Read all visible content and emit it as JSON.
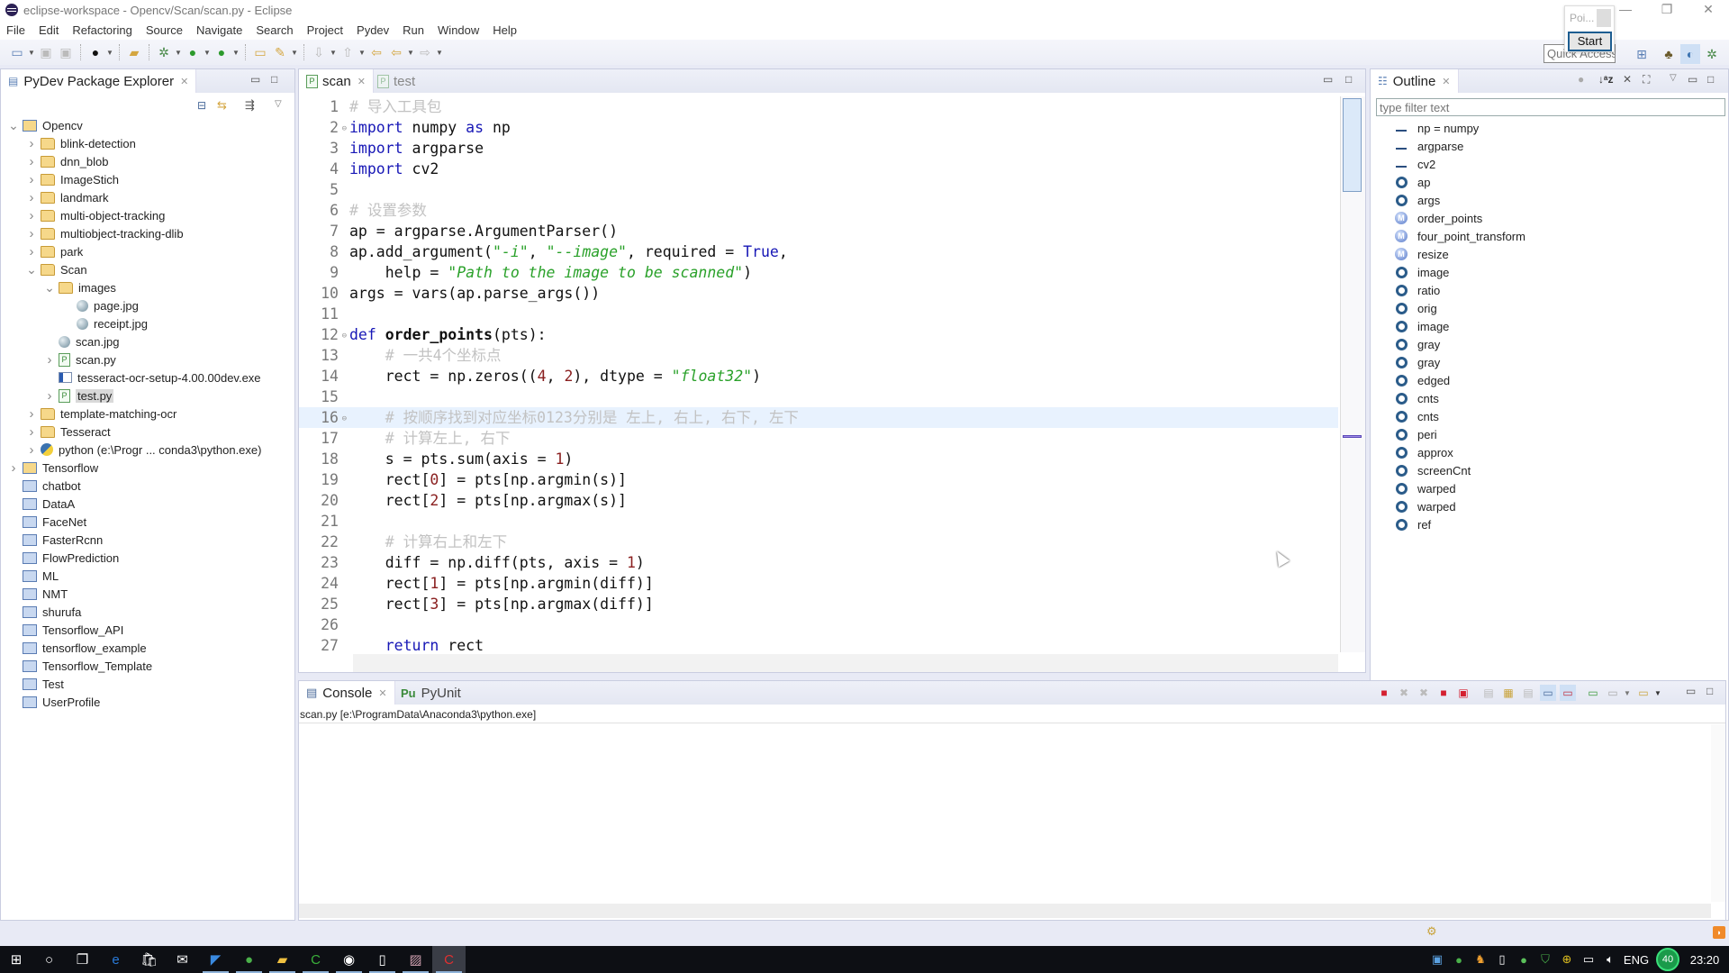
{
  "window": {
    "title": "eclipse-workspace - Opencv/Scan/scan.py - Eclipse",
    "controls": {
      "minimize": "—",
      "restore": "❐",
      "close": "✕"
    }
  },
  "menu": [
    "File",
    "Edit",
    "Refactoring",
    "Source",
    "Navigate",
    "Search",
    "Project",
    "Pydev",
    "Run",
    "Window",
    "Help"
  ],
  "toolbar": {
    "quick_access_placeholder": "Quick Access",
    "popup": {
      "text": "Poi...",
      "button": "Start"
    },
    "icons": [
      "new-icon",
      "save-icon",
      "save-all-icon",
      "profile-icon",
      "open-project-icon",
      "debug-icon",
      "run-icon",
      "external-tools-icon",
      "open-folder-icon",
      "pen-icon",
      "next-annotation-icon",
      "prev-annotation-icon",
      "last-edit-icon",
      "back-icon",
      "forward-icon"
    ],
    "perspectives": [
      "open-perspective-icon",
      "java-perspective-icon",
      "pydev-perspective-icon",
      "debug-perspective-icon"
    ]
  },
  "explorer": {
    "title": "PyDev Package Explorer",
    "tree": [
      {
        "label": "Opencv",
        "level": 0,
        "icon": "project",
        "expanded": true
      },
      {
        "label": "blink-detection",
        "level": 1,
        "icon": "folder",
        "collapsed": true
      },
      {
        "label": "dnn_blob",
        "level": 1,
        "icon": "folder",
        "collapsed": true
      },
      {
        "label": "ImageStich",
        "level": 1,
        "icon": "folder",
        "collapsed": true
      },
      {
        "label": "landmark",
        "level": 1,
        "icon": "folder",
        "collapsed": true
      },
      {
        "label": "multi-object-tracking",
        "level": 1,
        "icon": "folder",
        "collapsed": true
      },
      {
        "label": "multiobject-tracking-dlib",
        "level": 1,
        "icon": "folder",
        "collapsed": true
      },
      {
        "label": "park",
        "level": 1,
        "icon": "folder",
        "collapsed": true
      },
      {
        "label": "Scan",
        "level": 1,
        "icon": "folder",
        "expanded": true
      },
      {
        "label": "images",
        "level": 2,
        "icon": "folder",
        "expanded": true
      },
      {
        "label": "page.jpg",
        "level": 3,
        "icon": "image"
      },
      {
        "label": "receipt.jpg",
        "level": 3,
        "icon": "image"
      },
      {
        "label": "scan.jpg",
        "level": 2,
        "icon": "image"
      },
      {
        "label": "scan.py",
        "level": 2,
        "icon": "py",
        "collapsed": true
      },
      {
        "label": "tesseract-ocr-setup-4.00.00dev.exe",
        "level": 2,
        "icon": "exe"
      },
      {
        "label": "test.py",
        "level": 2,
        "icon": "py",
        "collapsed": true,
        "selected": true
      },
      {
        "label": "template-matching-ocr",
        "level": 1,
        "icon": "folder",
        "collapsed": true
      },
      {
        "label": "Tesseract",
        "level": 1,
        "icon": "folder",
        "collapsed": true
      },
      {
        "label": "python  (e:\\Progr ... conda3\\python.exe)",
        "level": 1,
        "icon": "python",
        "collapsed": true
      },
      {
        "label": "Tensorflow",
        "level": 0,
        "icon": "project",
        "collapsed": true
      },
      {
        "label": "chatbot",
        "level": 0,
        "icon": "closed"
      },
      {
        "label": "DataA",
        "level": 0,
        "icon": "closed"
      },
      {
        "label": "FaceNet",
        "level": 0,
        "icon": "closed"
      },
      {
        "label": "FasterRcnn",
        "level": 0,
        "icon": "closed"
      },
      {
        "label": "FlowPrediction",
        "level": 0,
        "icon": "closed"
      },
      {
        "label": "ML",
        "level": 0,
        "icon": "closed"
      },
      {
        "label": "NMT",
        "level": 0,
        "icon": "closed"
      },
      {
        "label": "shurufa",
        "level": 0,
        "icon": "closed"
      },
      {
        "label": "Tensorflow_API",
        "level": 0,
        "icon": "closed"
      },
      {
        "label": "tensorflow_example",
        "level": 0,
        "icon": "closed"
      },
      {
        "label": "Tensorflow_Template",
        "level": 0,
        "icon": "closed"
      },
      {
        "label": "Test",
        "level": 0,
        "icon": "closed"
      },
      {
        "label": "UserProfile",
        "level": 0,
        "icon": "closed"
      }
    ]
  },
  "editor": {
    "tabs": [
      {
        "label": "scan",
        "active": true
      },
      {
        "label": "test",
        "active": false
      }
    ],
    "current_line": 16,
    "lines": [
      [
        [
          "cmt",
          "# 导入工具包"
        ]
      ],
      [
        [
          "kw",
          "import"
        ],
        [
          "",
          " numpy "
        ],
        [
          "kw",
          "as"
        ],
        [
          "",
          " np"
        ]
      ],
      [
        [
          "kw",
          "import"
        ],
        [
          "",
          " argparse"
        ]
      ],
      [
        [
          "kw",
          "import"
        ],
        [
          "",
          " cv2"
        ]
      ],
      [],
      [
        [
          "cmt",
          "# 设置参数"
        ]
      ],
      [
        [
          "",
          "ap = argparse.ArgumentParser()"
        ]
      ],
      [
        [
          "",
          "ap.add_argument("
        ],
        [
          "str",
          "\"-i\""
        ],
        [
          "",
          ", "
        ],
        [
          "str",
          "\"--image\""
        ],
        [
          "",
          ", required = "
        ],
        [
          "kw",
          "True"
        ],
        [
          "",
          ","
        ]
      ],
      [
        [
          "",
          "    help = "
        ],
        [
          "str",
          "\"Path to the image to be scanned\""
        ],
        [
          "",
          ")"
        ]
      ],
      [
        [
          "",
          "args = vars(ap.parse_args())"
        ]
      ],
      [],
      [
        [
          "kw",
          "def"
        ],
        [
          "",
          " "
        ],
        [
          "fn",
          "order_points"
        ],
        [
          "",
          "(pts):"
        ]
      ],
      [
        [
          "",
          "    "
        ],
        [
          "cmt",
          "# 一共4个坐标点"
        ]
      ],
      [
        [
          "",
          "    rect = np.zeros(("
        ],
        [
          "num",
          "4"
        ],
        [
          "",
          ", "
        ],
        [
          "num",
          "2"
        ],
        [
          "",
          "), dtype = "
        ],
        [
          "str",
          "\"float32\""
        ],
        [
          "",
          ")"
        ]
      ],
      [],
      [
        [
          "",
          "    "
        ],
        [
          "cmt",
          "# 按顺序找到对应坐标0123分别是 左上, 右上, 右下, 左下"
        ]
      ],
      [
        [
          "",
          "    "
        ],
        [
          "cmt",
          "# 计算左上, 右下"
        ]
      ],
      [
        [
          "",
          "    s = pts.sum(axis = "
        ],
        [
          "num",
          "1"
        ],
        [
          "",
          ")"
        ]
      ],
      [
        [
          "",
          "    rect["
        ],
        [
          "num",
          "0"
        ],
        [
          "",
          "] = pts[np.argmin(s)]"
        ]
      ],
      [
        [
          "",
          "    rect["
        ],
        [
          "num",
          "2"
        ],
        [
          "",
          "] = pts[np.argmax(s)]"
        ]
      ],
      [],
      [
        [
          "",
          "    "
        ],
        [
          "cmt",
          "# 计算右上和左下"
        ]
      ],
      [
        [
          "",
          "    diff = np.diff(pts, axis = "
        ],
        [
          "num",
          "1"
        ],
        [
          "",
          ")"
        ]
      ],
      [
        [
          "",
          "    rect["
        ],
        [
          "num",
          "1"
        ],
        [
          "",
          "] = pts[np.argmin(diff)]"
        ]
      ],
      [
        [
          "",
          "    rect["
        ],
        [
          "num",
          "3"
        ],
        [
          "",
          "] = pts[np.argmax(diff)]"
        ]
      ],
      [],
      [
        [
          "",
          "    "
        ],
        [
          "kw",
          "return"
        ],
        [
          "",
          " rect"
        ]
      ]
    ],
    "fold_lines": [
      2,
      12,
      16
    ]
  },
  "outline": {
    "title": "Outline",
    "filter_placeholder": "type filter text",
    "items": [
      {
        "label": "np = numpy",
        "kind": "import"
      },
      {
        "label": "argparse",
        "kind": "import"
      },
      {
        "label": "cv2",
        "kind": "import"
      },
      {
        "label": "ap",
        "kind": "var"
      },
      {
        "label": "args",
        "kind": "var"
      },
      {
        "label": "order_points",
        "kind": "fn"
      },
      {
        "label": "four_point_transform",
        "kind": "fn"
      },
      {
        "label": "resize",
        "kind": "fn"
      },
      {
        "label": "image",
        "kind": "var"
      },
      {
        "label": "ratio",
        "kind": "var"
      },
      {
        "label": "orig",
        "kind": "var"
      },
      {
        "label": "image",
        "kind": "var"
      },
      {
        "label": "gray",
        "kind": "var"
      },
      {
        "label": "gray",
        "kind": "var"
      },
      {
        "label": "edged",
        "kind": "var"
      },
      {
        "label": "cnts",
        "kind": "var"
      },
      {
        "label": "cnts",
        "kind": "var"
      },
      {
        "label": "peri",
        "kind": "var"
      },
      {
        "label": "approx",
        "kind": "var"
      },
      {
        "label": "screenCnt",
        "kind": "var"
      },
      {
        "label": "warped",
        "kind": "var"
      },
      {
        "label": "warped",
        "kind": "var"
      },
      {
        "label": "ref",
        "kind": "var"
      }
    ]
  },
  "console": {
    "tabs": [
      {
        "label": "Console",
        "active": true
      },
      {
        "label": "PyUnit",
        "active": false
      }
    ],
    "process": "scan.py [e:\\ProgramData\\Anaconda3\\python.exe]"
  },
  "taskbar": {
    "apps": [
      "start-icon",
      "cortana-icon",
      "task-view-icon",
      "edge-icon",
      "store-icon",
      "mail-icon",
      "feishu-icon",
      "browser-icon",
      "file-explorer-icon",
      "camtasia-icon",
      "eclipse-icon",
      "notepad-icon",
      "paint-icon",
      "recorder-icon"
    ],
    "tray": {
      "language": "ENG",
      "badge": "40",
      "time": "23:20"
    }
  },
  "colors": {
    "keyword": "#1717b6",
    "string": "#2aa12a",
    "comment": "#c2c2c2",
    "number": "#8a2020",
    "current_line": "#e8f2fe"
  }
}
